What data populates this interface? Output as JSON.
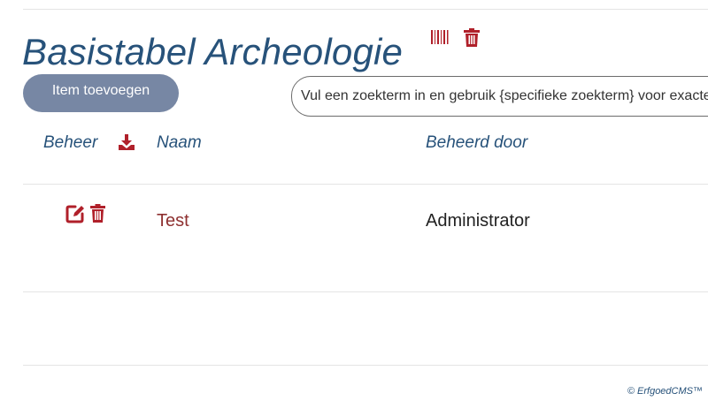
{
  "page": {
    "title": "Basistabel Archeologie"
  },
  "toolbar": {
    "add_item_label": "Item toevoegen",
    "search_placeholder": "Vul een zoekterm in en gebruik {specifieke zoekterm} voor exacte zoekresultaten"
  },
  "table": {
    "columns": [
      "Beheer",
      "Naam",
      "Beheerd door"
    ],
    "rows": [
      {
        "naam": "Test",
        "beheerd_door": "Administrator"
      }
    ]
  },
  "footer": {
    "copyright": "© ErfgoedCMS™"
  },
  "icons": {
    "title_actions": [
      "barcode-icon",
      "trash-icon"
    ],
    "header_action": "download-icon",
    "row_actions": [
      "edit-icon",
      "trash-icon"
    ]
  },
  "colors": {
    "heading": "#27527a",
    "action_red": "#b0202a",
    "button_bg": "#7787a4",
    "link": "#8e3030"
  }
}
